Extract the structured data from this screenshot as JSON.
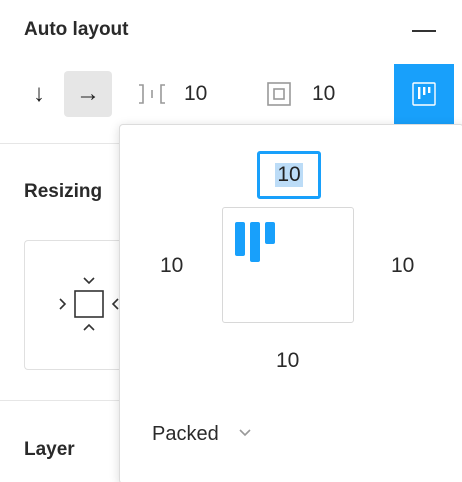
{
  "auto_layout": {
    "title": "Auto layout",
    "collapse_icon": "minus-icon",
    "direction_down_glyph": "↓",
    "direction_right_glyph": "→",
    "spacing_value": "10",
    "padding_value": "10"
  },
  "resizing": {
    "title": "Resizing"
  },
  "layer": {
    "title": "Layer"
  },
  "padding_popover": {
    "top": "10",
    "left": "10",
    "right": "10",
    "bottom": "10",
    "distribution": "Packed"
  },
  "colors": {
    "accent": "#18a0fb",
    "selection": "#bcdcf7"
  }
}
